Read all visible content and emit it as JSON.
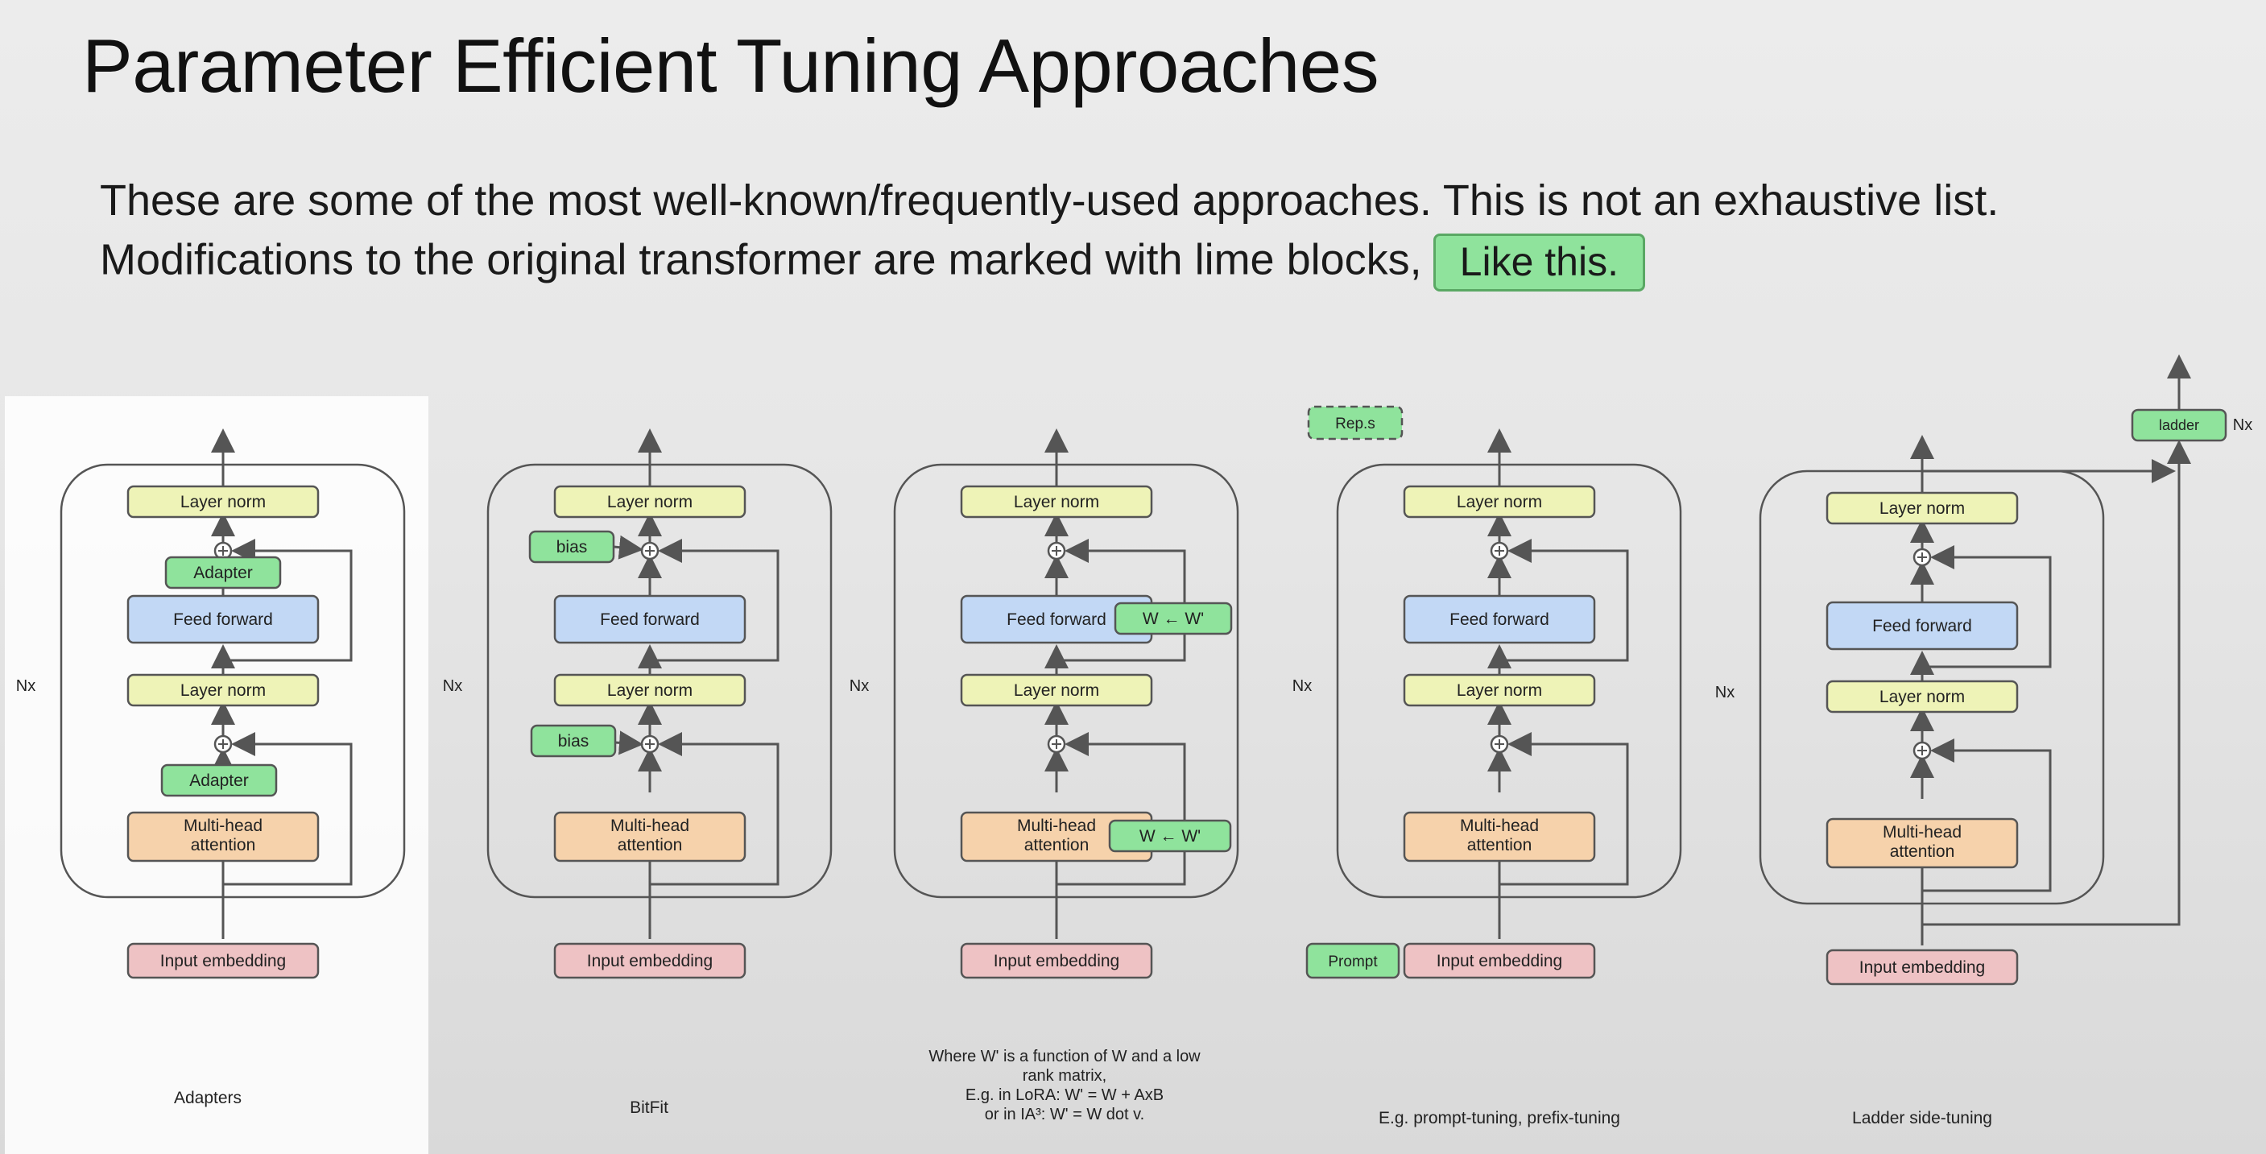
{
  "title": "Parameter Efficient Tuning Approaches",
  "subtitle": {
    "line1": "These are some of the most well-known/frequently-used approaches. This is not an exhaustive list.",
    "line2_prefix": "Modifications to the original transformer are marked with lime blocks,",
    "example_label": "Like this."
  },
  "colors": {
    "layer_norm": "#eef3b7",
    "feed_forward": "#c2d8f5",
    "attention": "#f6d2ab",
    "embedding": "#eec2c4",
    "modification": "#8fe39c"
  },
  "panels": [
    {
      "caption": "Adapters",
      "nx": "Nx",
      "blocks": {
        "layer_norm": "Layer norm",
        "feed_forward": "Feed forward",
        "mha_line1": "Multi-head",
        "mha_line2": "attention",
        "input_embedding": "Input embedding"
      },
      "modifications": {
        "adapter_top": "Adapter",
        "adapter_bottom": "Adapter"
      }
    },
    {
      "caption": "BitFit",
      "nx": "Nx",
      "blocks": {
        "layer_norm": "Layer norm",
        "feed_forward": "Feed forward",
        "mha_line1": "Multi-head",
        "mha_line2": "attention",
        "input_embedding": "Input embedding"
      },
      "modifications": {
        "bias_top": "bias",
        "bias_bottom": "bias"
      }
    },
    {
      "caption_lines": [
        "Where W' is a function of W and a low",
        "rank matrix,",
        "E.g. in LoRA:  W' = W + AxB",
        "or in IA³: W' = W dot v."
      ],
      "nx": "Nx",
      "blocks": {
        "layer_norm": "Layer norm",
        "feed_forward": "Feed forward",
        "mha_line1": "Multi-head",
        "mha_line2": "attention",
        "input_embedding": "Input embedding"
      },
      "modifications": {
        "w_ff": "W ← W'",
        "w_attn": "W ← W'"
      }
    },
    {
      "caption": "E.g. prompt-tuning, prefix-tuning",
      "nx": "Nx",
      "blocks": {
        "layer_norm": "Layer norm",
        "feed_forward": "Feed forward",
        "mha_line1": "Multi-head",
        "mha_line2": "attention",
        "input_embedding": "Input embedding"
      },
      "modifications": {
        "reps": "Rep.s",
        "prompt": "Prompt"
      }
    },
    {
      "caption": "Ladder side-tuning",
      "nx": "Nx",
      "blocks": {
        "layer_norm": "Layer norm",
        "feed_forward": "Feed forward",
        "mha_line1": "Multi-head",
        "mha_line2": "attention",
        "input_embedding": "Input embedding"
      },
      "modifications": {
        "ladder": "ladder",
        "ladder_nx": "Nx"
      }
    }
  ]
}
